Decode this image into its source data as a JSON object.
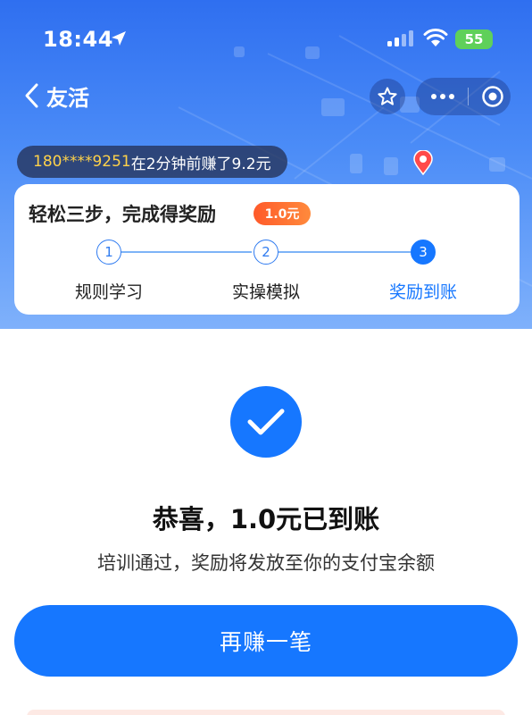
{
  "status_bar": {
    "time": "18:44",
    "battery": "55",
    "icons": [
      "location-arrow-icon",
      "signal-icon",
      "wifi-icon",
      "battery-icon"
    ]
  },
  "nav": {
    "title": "友活",
    "icons": [
      "back-icon",
      "star-icon",
      "more-icon",
      "target-icon"
    ]
  },
  "ticker": {
    "phone": "180****9251",
    "message": "在2分钟前赚了9.2元"
  },
  "steps_card": {
    "title": "轻松三步，完成得奖励",
    "reward_badge": "1.0元",
    "steps": [
      {
        "number": "1",
        "label": "规则学习",
        "active": false
      },
      {
        "number": "2",
        "label": "实操模拟",
        "active": false
      },
      {
        "number": "3",
        "label": "奖励到账",
        "active": true
      }
    ]
  },
  "result": {
    "headline": "恭喜，1.0元已到账",
    "subline": "培训通过，奖励将发放至你的支付宝余额",
    "button_label": "再赚一笔"
  },
  "colors": {
    "primary": "#1677ff",
    "hero_top": "#2f6ff0",
    "ticker_phone": "#ffd24a",
    "reward_badge": "#ff6a2e",
    "battery": "#5fd05a"
  }
}
